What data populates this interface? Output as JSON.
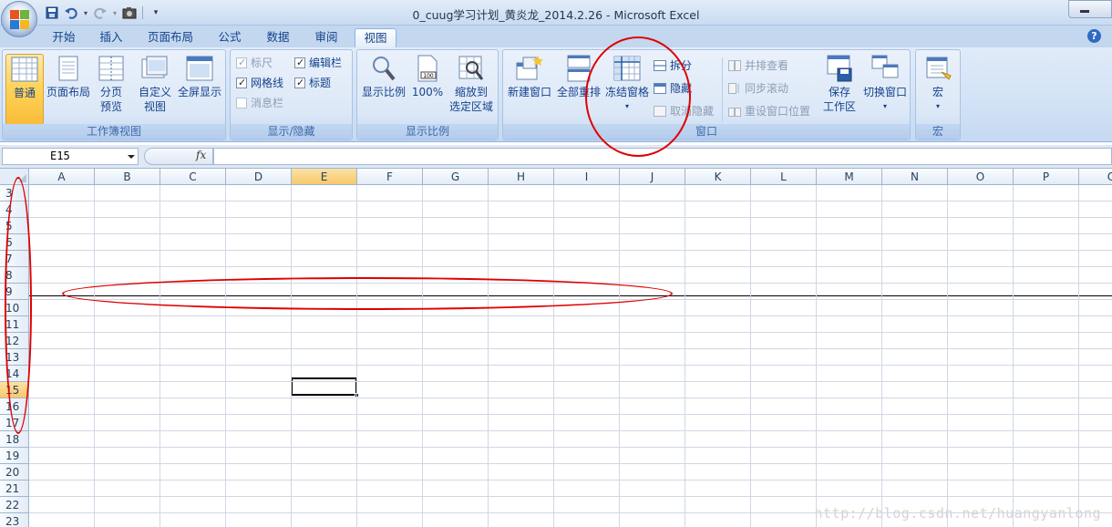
{
  "window": {
    "title": "0_cuug学习计划_黄炎龙_2014.2.26 - Microsoft Excel"
  },
  "tabs": [
    "开始",
    "插入",
    "页面布局",
    "公式",
    "数据",
    "审阅",
    "视图"
  ],
  "active_tab": "视图",
  "ribbon": {
    "workbook_views": {
      "label": "工作簿视图",
      "normal": "普通",
      "page_layout": "页面布局",
      "page_break_1": "分页",
      "page_break_2": "预览",
      "custom_1": "自定义",
      "custom_2": "视图",
      "full_screen": "全屏显示"
    },
    "show_hide": {
      "label": "显示/隐藏",
      "ruler": "标尺",
      "formula_bar": "编辑栏",
      "gridlines": "网格线",
      "headings": "标题",
      "message_bar": "消息栏"
    },
    "zoom": {
      "label": "显示比例",
      "zoom": "显示比例",
      "hundred": "100%",
      "fit_1": "缩放到",
      "fit_2": "选定区域"
    },
    "window": {
      "label": "窗口",
      "new_window": "新建窗口",
      "arrange_all": "全部重排",
      "freeze_panes": "冻结窗格",
      "split": "拆分",
      "hide": "隐藏",
      "unhide": "取消隐藏",
      "side_by_side": "并排查看",
      "sync_scroll": "同步滚动",
      "reset_position": "重设窗口位置",
      "save_workspace_1": "保存",
      "save_workspace_2": "工作区",
      "switch_windows": "切换窗口"
    },
    "macros": {
      "label": "宏",
      "macros": "宏"
    }
  },
  "formula_bar": {
    "name_box": "E15",
    "fx": "fx",
    "value": ""
  },
  "sheet": {
    "columns": [
      "A",
      "B",
      "C",
      "D",
      "E",
      "F",
      "G",
      "H",
      "I",
      "J",
      "K",
      "L",
      "M",
      "N",
      "O",
      "P",
      "Q"
    ],
    "rows": [
      "3",
      "4",
      "5",
      "6",
      "7",
      "8",
      "9",
      "10",
      "11",
      "12",
      "13",
      "14",
      "15",
      "16",
      "17",
      "18",
      "19",
      "20",
      "21",
      "22",
      "23"
    ],
    "selected_column": "E",
    "selected_row": "15"
  },
  "watermark": "http://blog.csdn.net/huangyanlong",
  "colors": {
    "annotation": "#e00000",
    "selection": "#f9c86a",
    "ribbon_text": "#15428b"
  }
}
